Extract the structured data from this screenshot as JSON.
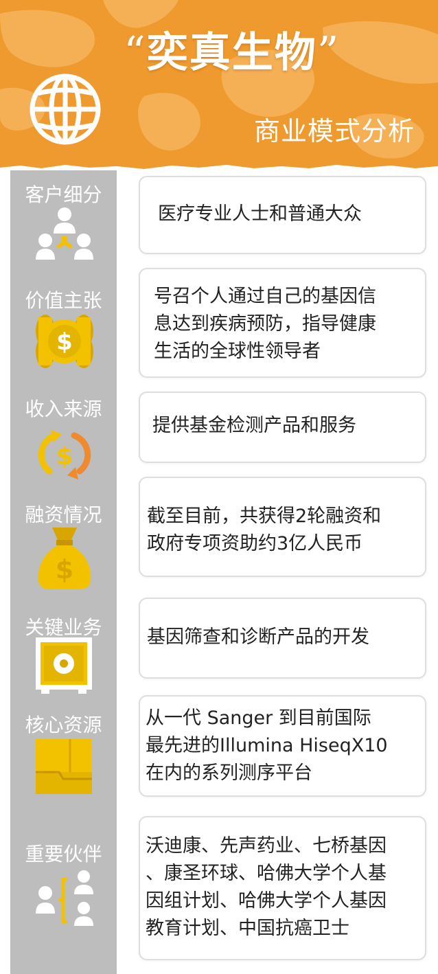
{
  "header": {
    "title_open_quote": "“",
    "title": "奕真生物",
    "title_close_quote": "”",
    "subtitle": "商业模式分析",
    "background_color": "#ef9a2e",
    "icon": "globe-icon"
  },
  "sections": [
    {
      "label": "客户细分",
      "icon": "people-group-icon",
      "text": "医疗专业人士和普通大众"
    },
    {
      "label": "价值主张",
      "icon": "coins-icon",
      "text": "号召个人通过自己的基因信\n息达到疾病预防，指导健康\n生活的全球性领导者"
    },
    {
      "label": "收入来源",
      "icon": "money-cycle-icon",
      "text": "提供基金检测产品和服务"
    },
    {
      "label": "融资情况",
      "icon": "money-bag-icon",
      "text": "截至目前，共获得2轮融资和\n政府专项资助约3亿人民币"
    },
    {
      "label": "关键业务",
      "icon": "safe-icon",
      "text": "基因筛查和诊断产品的开发"
    },
    {
      "label": "核心资源",
      "icon": "folder-icon",
      "text": "从一代 Sanger 到目前国际\n最先进的Illumina HiseqX10\n在内的系列测序平台"
    },
    {
      "label": "重要伙伴",
      "icon": "partners-icon",
      "text": "沃迪康、先声药业、七桥基因\n、康圣环球、哈佛大学个人基\n因组计划、哈佛大学个人基因\n教育计划、中国抗癌卫士"
    }
  ],
  "colors": {
    "accent_orange": "#ef9a2e",
    "side_column": "#bdbdbd",
    "icon_yellow": "#f2c200",
    "icon_dark_yellow": "#d9a600"
  }
}
